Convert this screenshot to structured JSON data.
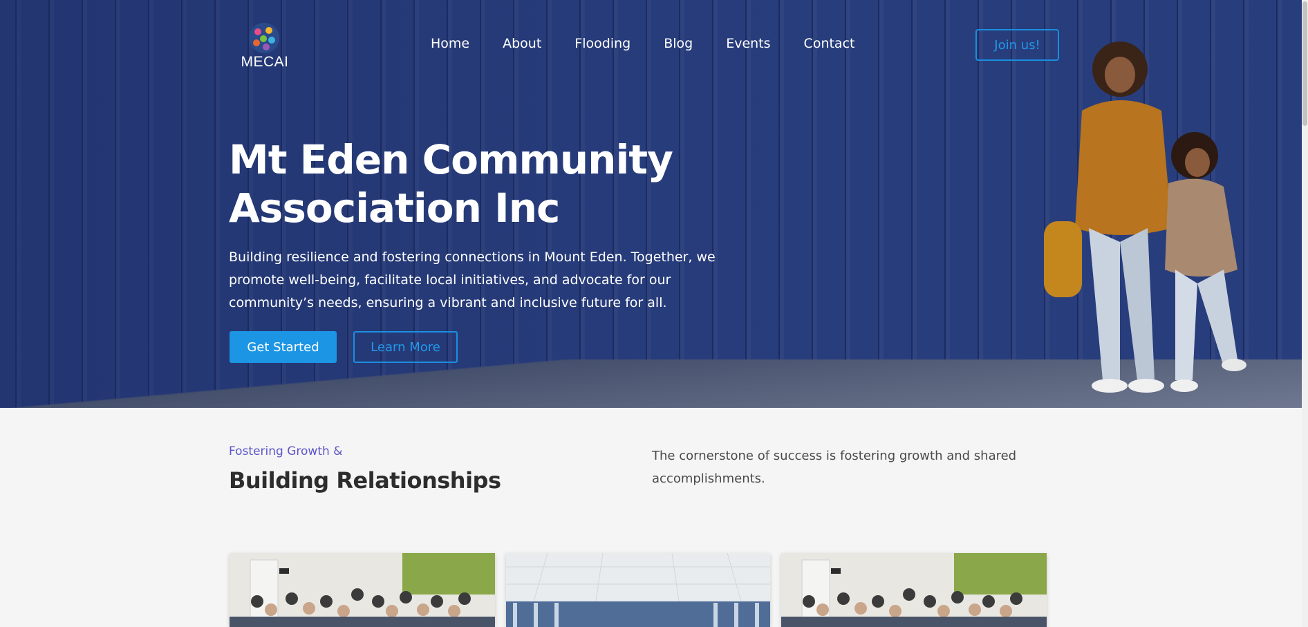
{
  "header": {
    "logo_text": "MECAI",
    "nav": [
      "Home",
      "About",
      "Flooding",
      "Blog",
      "Events",
      "Contact"
    ],
    "join_label": "Join us!"
  },
  "hero": {
    "title_line1": "Mt Eden Community",
    "title_line2": "Association Inc",
    "subtitle": "Building resilience and fostering connections in Mount Eden. Together, we promote well-being, facilitate local initiatives, and advocate for our community’s needs, ensuring a vibrant and inclusive future for all.",
    "primary_button": "Get Started",
    "secondary_button": "Learn More"
  },
  "section": {
    "eyebrow": "Fostering Growth &",
    "title": "Building Relationships",
    "text": "The cornerstone of success is fostering growth and shared accomplishments."
  },
  "colors": {
    "hero_bg": "#283d7c",
    "accent": "#1b95e4",
    "eyebrow": "#5b55c9"
  }
}
